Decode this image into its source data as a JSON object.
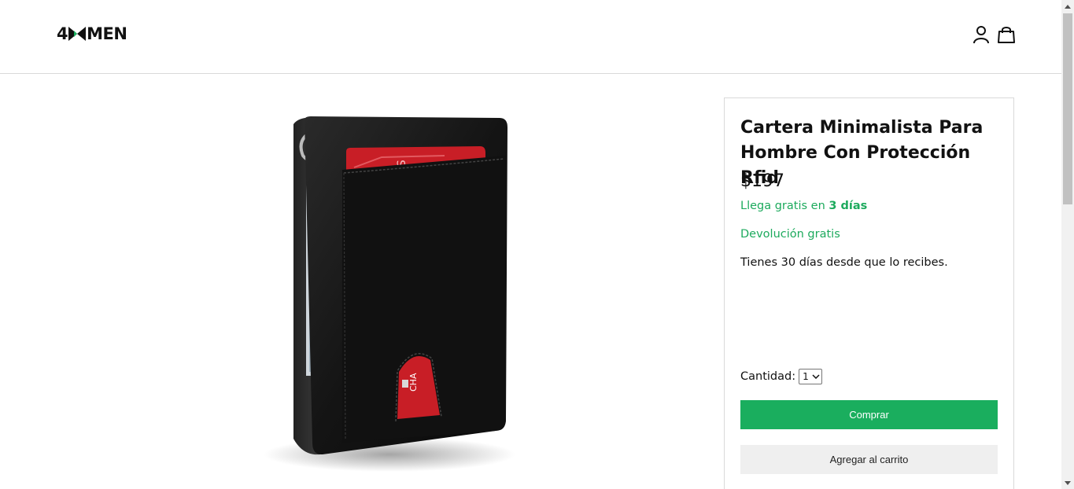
{
  "header": {
    "logo_left": "4",
    "logo_right": "MEN",
    "account_icon": "user-icon",
    "cart_icon": "shopping-bag-icon"
  },
  "product": {
    "image_alt": "wallet-photo",
    "title": "Cartera Minimalista Para Hombre Con Protección Rfid",
    "price": "$197",
    "shipping_prefix": "Llega gratis en ",
    "shipping_days": "3 días",
    "returns_title": "Devolución gratis",
    "returns_note": "Tienes 30 días desde que lo recibes.",
    "quantity_label": "Cantidad:",
    "quantity_value": "1",
    "buy_label": "Comprar",
    "add_to_cart_label": "Agregar al carrito"
  },
  "colors": {
    "accent_green": "#1aae5e",
    "text_green": "#1daa5d",
    "border": "#d9d9d9",
    "secondary_button": "#efefef"
  }
}
